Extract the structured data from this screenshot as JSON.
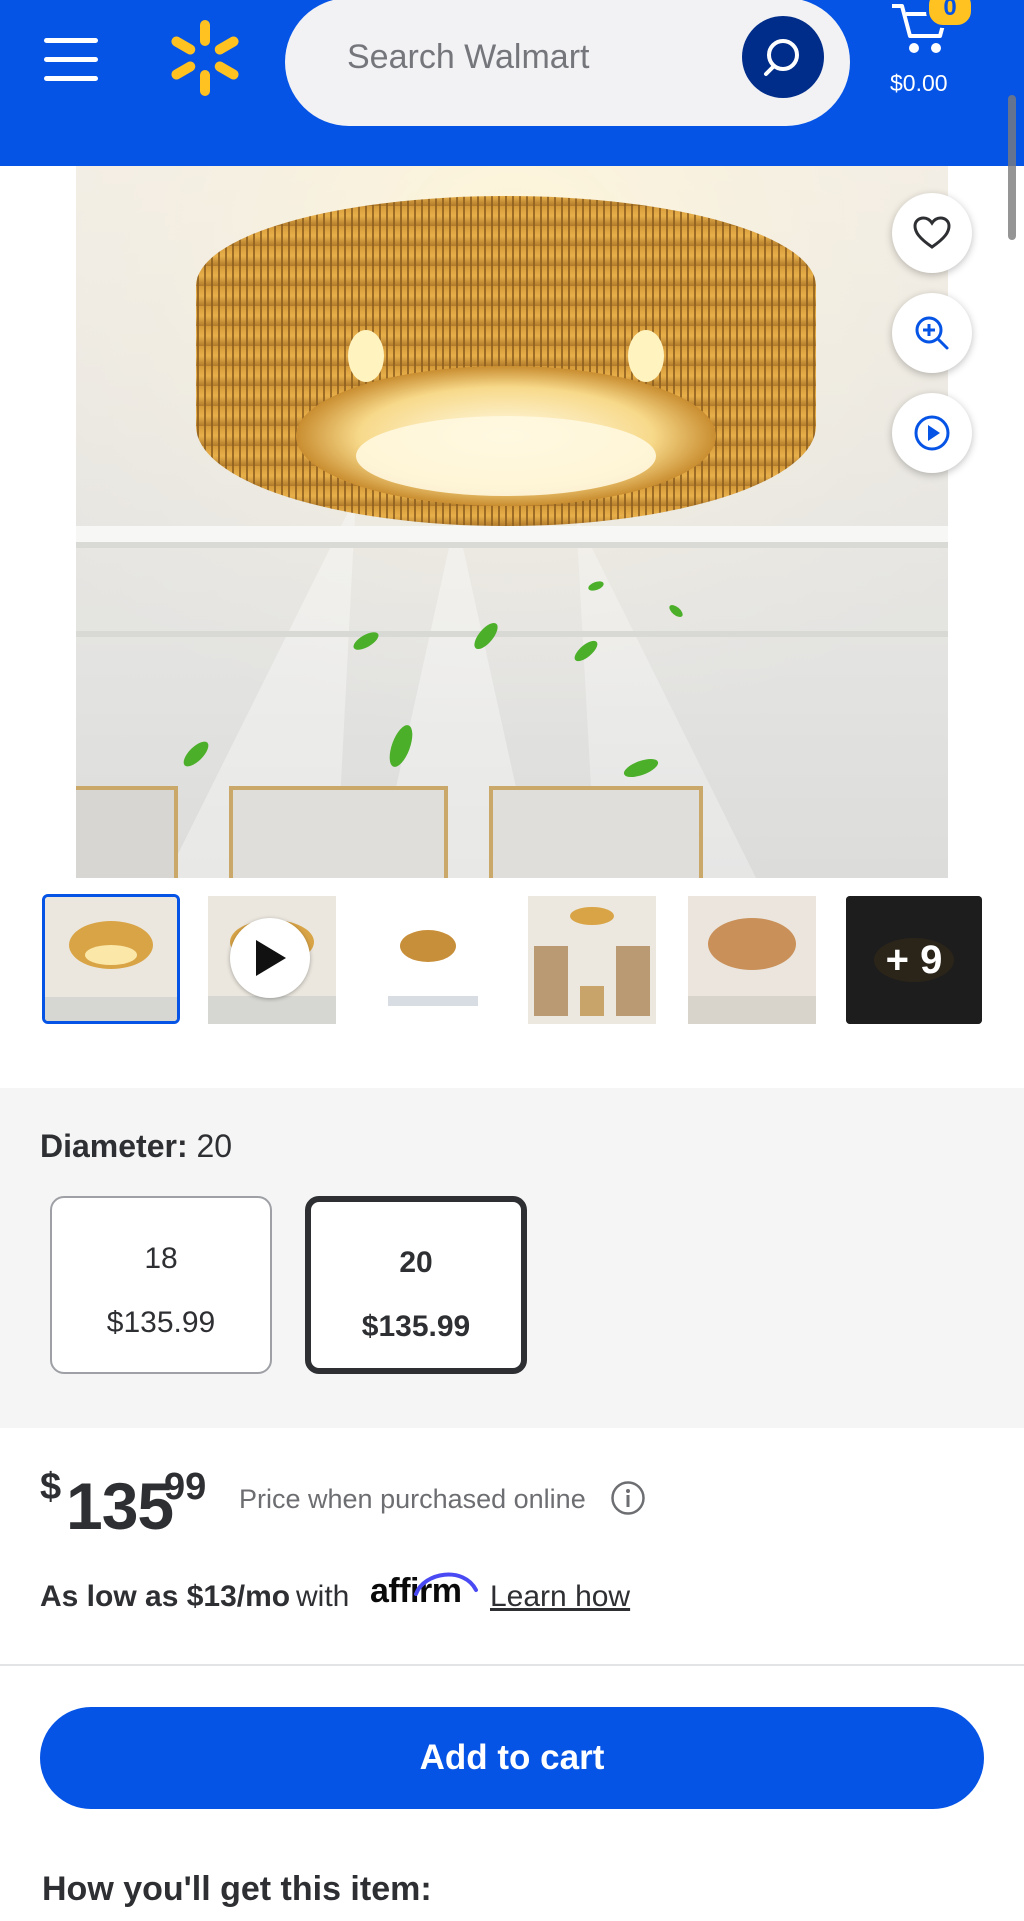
{
  "header": {
    "search_placeholder": "Search Walmart",
    "cart_count": "0",
    "cart_total": "$0.00",
    "brand_color": "#0654e6",
    "spark_color": "#ffc220",
    "icons": [
      "menu-icon",
      "walmart-spark-logo",
      "search-icon",
      "cart-icon"
    ]
  },
  "gallery": {
    "side_actions": [
      "heart-icon",
      "zoom-in-icon",
      "play-video-icon"
    ],
    "thumbnails_count": 6,
    "more_label": "+ 9"
  },
  "variants": {
    "label": "Diameter:",
    "selected_value": "20",
    "options": [
      {
        "size": "18",
        "price": "$135.99",
        "selected": false
      },
      {
        "size": "20",
        "price": "$135.99",
        "selected": true
      }
    ]
  },
  "price": {
    "currency": "$",
    "dollars": "135",
    "cents": "99",
    "note": "Price when purchased online"
  },
  "financing": {
    "text": "As low as $13/mo",
    "with": "with",
    "provider": "affirm",
    "link": "Learn how"
  },
  "cta": {
    "add_to_cart": "Add to cart"
  },
  "fulfillment": {
    "heading": "How you'll get this item:"
  }
}
